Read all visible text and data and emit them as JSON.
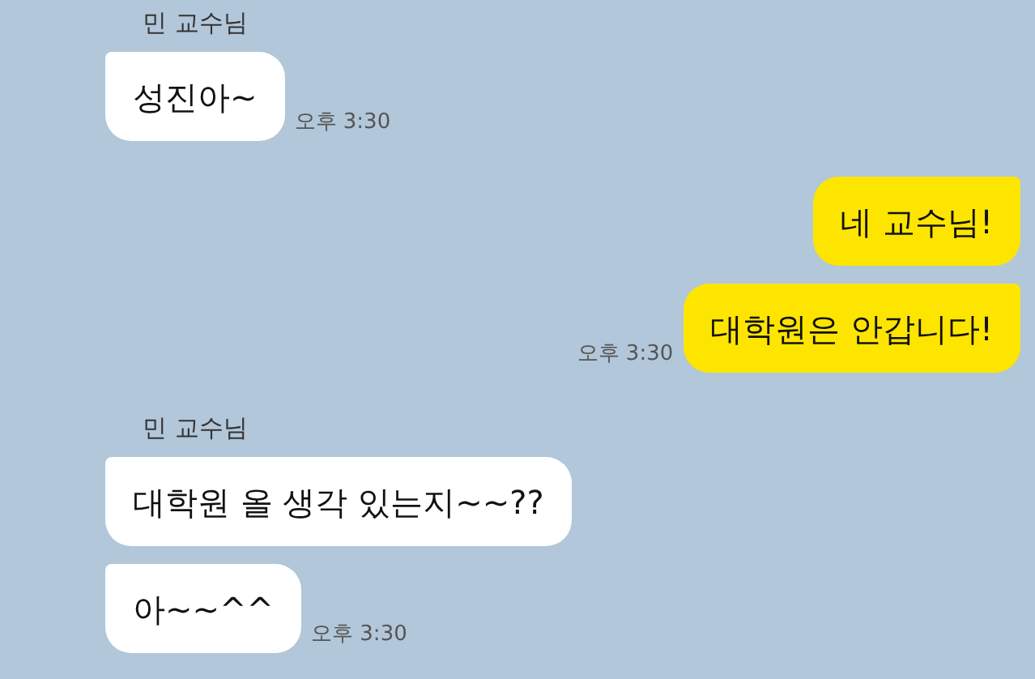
{
  "messages": [
    {
      "kind": "incoming",
      "sender": "민 교수님",
      "bubbles": [
        "성진아~"
      ],
      "time": "오후 3:30"
    },
    {
      "kind": "outgoing",
      "bubbles": [
        "네 교수님!",
        "대학원은 안갑니다!"
      ],
      "time": "오후 3:30"
    },
    {
      "kind": "incoming",
      "sender": "민 교수님",
      "bubbles": [
        "대학원 올 생각 있는지~~??",
        "아~~^^"
      ],
      "time": "오후 3:30"
    }
  ]
}
